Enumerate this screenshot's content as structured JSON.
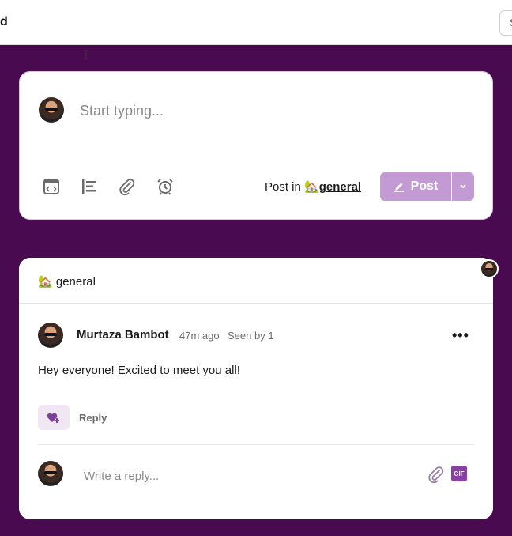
{
  "topbar": {
    "title_fragment": "d",
    "right_button_fragment": "S"
  },
  "composer": {
    "placeholder": "Start typing...",
    "post_in_label": "Post in",
    "channel_emoji": "🏡",
    "channel_name": "general",
    "post_label": "Post",
    "tools": [
      "code-block-icon",
      "list-icon",
      "attachment-icon",
      "alarm-clock-icon"
    ]
  },
  "thread": {
    "channel_emoji": "🏡",
    "channel_name": "general",
    "message": {
      "author": "Murtaza Bambot",
      "time": "47m ago",
      "seen": "Seen by 1",
      "body": "Hey everyone! Excited to meet you all!"
    },
    "reply_label": "Reply",
    "reply_placeholder": "Write a reply...",
    "gif_label": "GIF"
  },
  "colors": {
    "background": "#4a0a4f",
    "accent": "#c49ad4",
    "gif": "#8a3fa6"
  }
}
